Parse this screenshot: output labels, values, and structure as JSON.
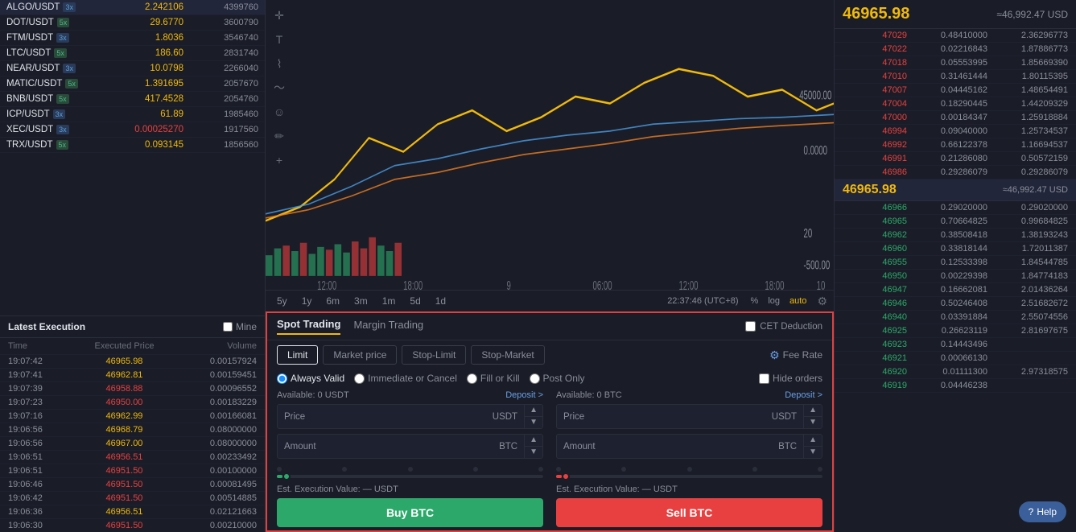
{
  "sidebar": {
    "pairs": [
      {
        "name": "ALGO/USDT",
        "leverage": "3x",
        "leverageType": "x3",
        "price": "2.242106",
        "priceClass": "up",
        "volume": "4399760"
      },
      {
        "name": "DOT/USDT",
        "leverage": "5x",
        "leverageType": "x5",
        "price": "29.6770",
        "priceClass": "up",
        "volume": "3600790"
      },
      {
        "name": "FTM/USDT",
        "leverage": "3x",
        "leverageType": "x3",
        "price": "1.8036",
        "priceClass": "up",
        "volume": "3546740"
      },
      {
        "name": "LTC/USDT",
        "leverage": "5x",
        "leverageType": "x5",
        "price": "186.60",
        "priceClass": "up",
        "volume": "2831740"
      },
      {
        "name": "NEAR/USDT",
        "leverage": "3x",
        "leverageType": "x3",
        "price": "10.0798",
        "priceClass": "up",
        "volume": "2266040"
      },
      {
        "name": "MATIC/USDT",
        "leverage": "5x",
        "leverageType": "x5",
        "price": "1.391695",
        "priceClass": "up",
        "volume": "2057670"
      },
      {
        "name": "BNB/USDT",
        "leverage": "5x",
        "leverageType": "x5",
        "price": "417.4528",
        "priceClass": "up",
        "volume": "2054760"
      },
      {
        "name": "ICP/USDT",
        "leverage": "3x",
        "leverageType": "x3",
        "price": "61.89",
        "priceClass": "up",
        "volume": "1985460"
      },
      {
        "name": "XEC/USDT",
        "leverage": "3x",
        "leverageType": "x3",
        "price": "0.00025270",
        "priceClass": "red",
        "volume": "1917560"
      },
      {
        "name": "TRX/USDT",
        "leverage": "5x",
        "leverageType": "x5",
        "price": "0.093145",
        "priceClass": "up",
        "volume": "1856560"
      }
    ]
  },
  "latestExecution": {
    "title": "Latest Execution",
    "mine_label": "Mine",
    "columns": {
      "time": "Time",
      "price": "Executed Price",
      "volume": "Volume"
    },
    "rows": [
      {
        "time": "19:07:42",
        "price": "46965.98",
        "priceClass": "up",
        "volume": "0.00157924"
      },
      {
        "time": "19:07:41",
        "price": "46962.81",
        "priceClass": "up",
        "volume": "0.00159451"
      },
      {
        "time": "19:07:39",
        "price": "46958.88",
        "priceClass": "dn",
        "volume": "0.00096552"
      },
      {
        "time": "19:07:23",
        "price": "46950.00",
        "priceClass": "dn",
        "volume": "0.00183229"
      },
      {
        "time": "19:07:16",
        "price": "46962.99",
        "priceClass": "up",
        "volume": "0.00166081"
      },
      {
        "time": "19:06:56",
        "price": "46968.79",
        "priceClass": "up",
        "volume": "0.08000000"
      },
      {
        "time": "19:06:56",
        "price": "46967.00",
        "priceClass": "up",
        "volume": "0.08000000"
      },
      {
        "time": "19:06:51",
        "price": "46956.51",
        "priceClass": "dn",
        "volume": "0.00233492"
      },
      {
        "time": "19:06:51",
        "price": "46951.50",
        "priceClass": "dn",
        "volume": "0.00100000"
      },
      {
        "time": "19:06:46",
        "price": "46951.50",
        "priceClass": "dn",
        "volume": "0.00081495"
      },
      {
        "time": "19:06:42",
        "price": "46951.50",
        "priceClass": "dn",
        "volume": "0.00514885"
      },
      {
        "time": "19:06:36",
        "price": "46956.51",
        "priceClass": "up",
        "volume": "0.02121663"
      },
      {
        "time": "19:06:30",
        "price": "46951.50",
        "priceClass": "dn",
        "volume": "0.00210000"
      }
    ]
  },
  "chart": {
    "timePeriods": [
      "5y",
      "1y",
      "6m",
      "3m",
      "1m",
      "5d",
      "1d"
    ],
    "timestamp": "22:37:46 (UTC+8)",
    "options": [
      "%",
      "log",
      "auto"
    ],
    "activeOption": "auto",
    "priceLabel": "45000.00",
    "priceLabelLow": "-500.00",
    "volumeLabel": "20"
  },
  "tradingPanel": {
    "tabs": [
      "Spot Trading",
      "Margin Trading"
    ],
    "activeTab": "Spot Trading",
    "cetDeduction": "CET Deduction",
    "orderTypes": [
      "Limit",
      "Market price",
      "Stop-Limit",
      "Stop-Market"
    ],
    "activeOrderType": "Limit",
    "feeRate": "Fee Rate",
    "timeInForce": [
      {
        "label": "Always Valid",
        "selected": true
      },
      {
        "label": "Immediate or Cancel",
        "selected": false
      },
      {
        "label": "Fill or Kill",
        "selected": false
      },
      {
        "label": "Post Only",
        "selected": false
      }
    ],
    "hideOrders": "Hide orders",
    "buy": {
      "available": "Available: 0 USDT",
      "deposit": "Deposit >",
      "price_label": "Price",
      "price_currency": "USDT",
      "amount_label": "Amount",
      "amount_currency": "BTC",
      "est": "Est. Execution Value: — USDT",
      "button": "Buy BTC"
    },
    "sell": {
      "available": "Available: 0 BTC",
      "deposit": "Deposit >",
      "price_label": "Price",
      "price_currency": "USDT",
      "amount_label": "Amount",
      "amount_currency": "BTC",
      "est": "Est. Execution Value: — USDT",
      "button": "Sell BTC"
    }
  },
  "orderBook": {
    "currentPrice": "46965.98",
    "approxPrice": "≈46,992.47 USD",
    "asks": [
      {
        "price": "47029",
        "size": "0.48410000",
        "total": "2.36296773"
      },
      {
        "price": "47022",
        "size": "0.02216843",
        "total": "1.87886773"
      },
      {
        "price": "47018",
        "size": "0.05553995",
        "total": "1.85669390"
      },
      {
        "price": "47010",
        "size": "0.31461444",
        "total": "1.80115395"
      },
      {
        "price": "47007",
        "size": "0.04445162",
        "total": "1.48654491"
      },
      {
        "price": "47004",
        "size": "0.18290445",
        "total": "1.44209329"
      },
      {
        "price": "47000",
        "size": "0.00184347",
        "total": "1.25918884"
      },
      {
        "price": "46994",
        "size": "0.09040000",
        "total": "1.25734537"
      },
      {
        "price": "46992",
        "size": "0.66122378",
        "total": "1.16694537"
      },
      {
        "price": "46991",
        "size": "0.21286080",
        "total": "0.50572159"
      },
      {
        "price": "46986",
        "size": "0.29286079",
        "total": "0.29286079"
      }
    ],
    "bids": [
      {
        "price": "46966",
        "size": "0.29020000",
        "total": "0.29020000"
      },
      {
        "price": "46965",
        "size": "0.70664825",
        "total": "0.99684825"
      },
      {
        "price": "46962",
        "size": "0.38508418",
        "total": "1.38193243"
      },
      {
        "price": "46960",
        "size": "0.33818144",
        "total": "1.72011387"
      },
      {
        "price": "46955",
        "size": "0.12533398",
        "total": "1.84544785"
      },
      {
        "price": "46950",
        "size": "0.00229398",
        "total": "1.84774183"
      },
      {
        "price": "46947",
        "size": "0.16662081",
        "total": "2.01436264"
      },
      {
        "price": "46946",
        "size": "0.50246408",
        "total": "2.51682672"
      },
      {
        "price": "46940",
        "size": "0.03391884",
        "total": "2.55074556"
      },
      {
        "price": "46925",
        "size": "0.26623119",
        "total": "2.81697675"
      },
      {
        "price": "46923",
        "size": "0.14443496",
        "total": ""
      },
      {
        "price": "46921",
        "size": "0.00066130",
        "total": ""
      },
      {
        "price": "46920",
        "size": "0.01111300",
        "total": "2.97318575"
      },
      {
        "price": "46919",
        "size": "0.04446238",
        "total": ""
      }
    ]
  },
  "help": {
    "label": "Help"
  }
}
